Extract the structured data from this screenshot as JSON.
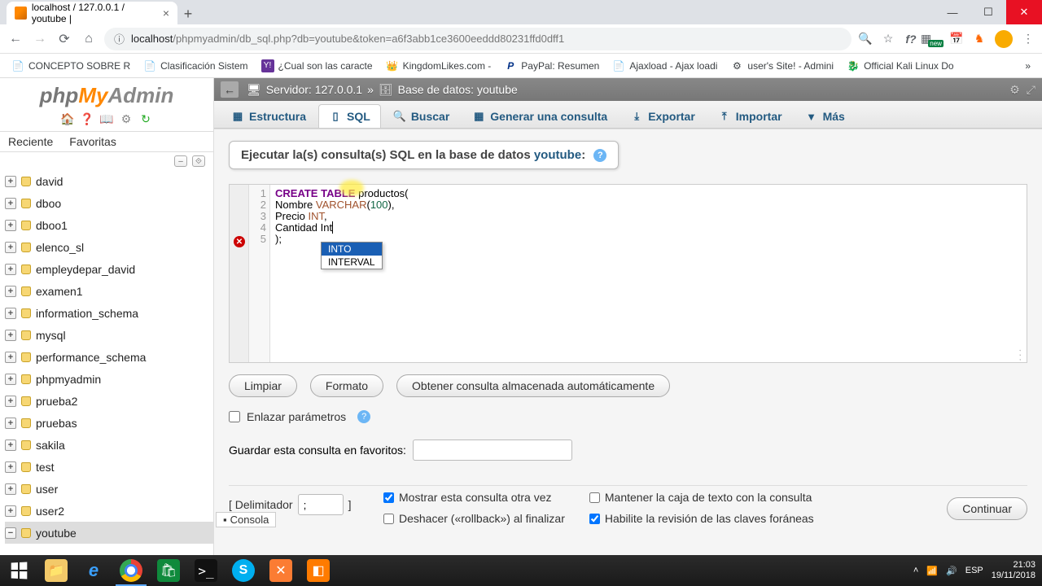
{
  "browser": {
    "tab_title": "localhost / 127.0.0.1 / youtube |",
    "url_host": "localhost",
    "url_path": "/phpmyadmin/db_sql.php?db=youtube&token=a6f3abb1ce3600eeddd80231ffd0dff1",
    "bookmarks": [
      {
        "label": "CONCEPTO SOBRE R",
        "icon": "doc"
      },
      {
        "label": "Clasificación Sistem",
        "icon": "doc"
      },
      {
        "label": "¿Cual son las caracte",
        "icon": "y"
      },
      {
        "label": "KingdomLikes.com -",
        "icon": "crown"
      },
      {
        "label": "PayPal: Resumen",
        "icon": "pp"
      },
      {
        "label": "Ajaxload - Ajax loadi",
        "icon": "doc"
      },
      {
        "label": "user's Site! - Admini",
        "icon": "gear"
      },
      {
        "label": "Official Kali Linux Do",
        "icon": "kali"
      }
    ],
    "ext_new": "new"
  },
  "pma": {
    "side_tabs": {
      "recent": "Reciente",
      "fav": "Favoritas"
    },
    "databases": [
      "david",
      "dboo",
      "dboo1",
      "elenco_sl",
      "empleydepar_david",
      "examen1",
      "information_schema",
      "mysql",
      "performance_schema",
      "phpmyadmin",
      "prueba2",
      "pruebas",
      "sakila",
      "test",
      "user",
      "user2",
      "youtube"
    ],
    "selected_db": "youtube",
    "breadcrumb": {
      "server_label": "Servidor: 127.0.0.1",
      "db_label": "Base de datos: youtube",
      "sep": "»"
    },
    "tabs": [
      {
        "key": "structure",
        "label": "Estructura",
        "icon": "▦"
      },
      {
        "key": "sql",
        "label": "SQL",
        "icon": "▯"
      },
      {
        "key": "search",
        "label": "Buscar",
        "icon": "🔍"
      },
      {
        "key": "query",
        "label": "Generar una consulta",
        "icon": "▦"
      },
      {
        "key": "export",
        "label": "Exportar",
        "icon": "⤓"
      },
      {
        "key": "import",
        "label": "Importar",
        "icon": "⤒"
      },
      {
        "key": "more",
        "label": "Más",
        "icon": "▼"
      }
    ],
    "active_tab": "sql",
    "panel_title_pre": "Ejecutar la(s) consulta(s) SQL en la base de datos ",
    "panel_title_db": "youtube",
    "panel_title_post": ":",
    "code_lines": [
      [
        {
          "t": "CREATE",
          "c": "kw"
        },
        {
          "t": " "
        },
        {
          "t": "TABLE",
          "c": "kw"
        },
        {
          "t": " productos("
        }
      ],
      [
        {
          "t": "Nombre "
        },
        {
          "t": "VARCHAR",
          "c": "kw2"
        },
        {
          "t": "("
        },
        {
          "t": "100",
          "c": "num"
        },
        {
          "t": "),"
        }
      ],
      [
        {
          "t": "Precio "
        },
        {
          "t": "INT",
          "c": "kw2"
        },
        {
          "t": ","
        }
      ],
      [
        {
          "t": "Cantidad "
        },
        {
          "t": "Int",
          "c": "cursor"
        }
      ],
      [
        {
          "t": ");"
        }
      ]
    ],
    "autocomplete": {
      "options": [
        "INTO",
        "INTERVAL"
      ],
      "selected": 0
    },
    "buttons": {
      "clear": "Limpiar",
      "format": "Formato",
      "retrieve": "Obtener consulta almacenada automáticamente"
    },
    "bind_params": "Enlazar parámetros",
    "save_fav_label": "Guardar esta consulta en favoritos:",
    "save_fav_value": "",
    "delimiter": {
      "label": "[ Delimitador",
      "value": ";",
      "close": "]"
    },
    "checks": {
      "show_again": {
        "label": "Mostrar esta consulta otra vez",
        "checked": true
      },
      "keep_box": {
        "label": "Mantener la caja de texto con la consulta",
        "checked": false
      },
      "rollback": {
        "label": "Deshacer («rollback») al finalizar",
        "checked": false
      },
      "fk": {
        "label": "Habilite la revisión de las claves foráneas",
        "checked": true
      }
    },
    "continue": "Continuar",
    "console": "Consola"
  },
  "taskbar": {
    "icons": [
      "files",
      "ie",
      "chrome",
      "store",
      "cmd",
      "skype",
      "xampp",
      "snip"
    ],
    "tray": {
      "lang": "ESP",
      "time": "21:03",
      "date": "19/11/2018"
    }
  }
}
